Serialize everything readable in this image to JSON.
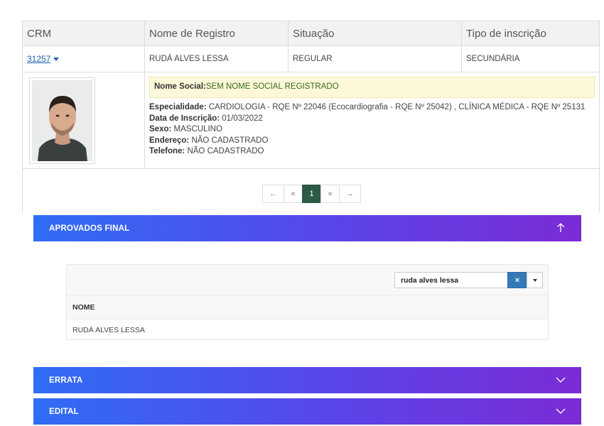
{
  "table": {
    "headers": [
      "CRM",
      "Nome de Registro",
      "Situação",
      "Tipo de inscrição"
    ],
    "row": {
      "crm": "31257",
      "nome": "RUDÁ ALVES LESSA",
      "situacao": "REGULAR",
      "tipo": "SECUNDÁRIA"
    },
    "details": {
      "nome_social_label": "Nome Social:",
      "nome_social_value": " SEM NOME SOCIAL REGISTRADO",
      "especialidade_label": "Especialidade:",
      "especialidade_value": " CARDIOLOGIA - RQE Nº 22046 (Ecocardiografia - RQE Nº 25042) , CLÍNICA MÉDICA - RQE Nº 25131",
      "data_label": "Data de Inscrição:",
      "data_value": " 01/03/2022",
      "sexo_label": "Sexo:",
      "sexo_value": " MASCULINO",
      "endereco_label": "Endereço:",
      "endereco_value": " NÃO CADASTRADO",
      "telefone_label": "Telefone:",
      "telefone_value": " NÃO CADASTRADO"
    }
  },
  "pagination": {
    "first": "←",
    "prev": "«",
    "current": "1",
    "next": "»",
    "last": "→"
  },
  "sections": {
    "aprovados": "APROVADOS FINAL",
    "errata": "ERRATA",
    "edital": "EDITAL"
  },
  "search": {
    "value": "ruda alves lessa",
    "clear_label": "×",
    "column_header": "NOME",
    "result": "RUDÁ ALVES LESSA"
  },
  "colors": {
    "active_page": "#2d5a45",
    "banner_start": "#2f6df5",
    "banner_end": "#7b2bd6",
    "clear_button": "#337ab7"
  }
}
